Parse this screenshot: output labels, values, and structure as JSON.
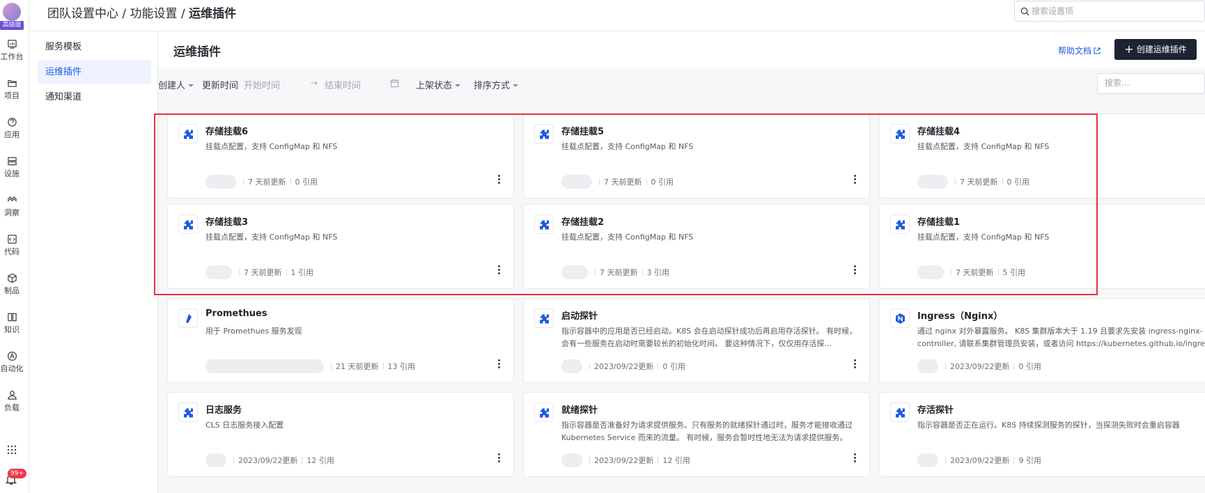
{
  "rail": {
    "badge": "高级版",
    "items": [
      {
        "label": "工作台",
        "icon": "dashboard-icon"
      },
      {
        "label": "项目",
        "icon": "folder-icon"
      },
      {
        "label": "应用",
        "icon": "app-icon"
      },
      {
        "label": "设施",
        "icon": "server-icon"
      },
      {
        "label": "洞察",
        "icon": "insight-icon"
      },
      {
        "label": "代码",
        "icon": "code-icon"
      },
      {
        "label": "制品",
        "icon": "package-icon"
      },
      {
        "label": "知识",
        "icon": "book-icon"
      },
      {
        "label": "自动化",
        "icon": "automation-icon"
      },
      {
        "label": "负载",
        "icon": "user-icon"
      }
    ],
    "notification_count": "99+"
  },
  "header": {
    "breadcrumb": [
      "团队设置中心",
      "功能设置",
      "运维插件"
    ],
    "separator": " / ",
    "search_placeholder": "搜索设置项"
  },
  "subnav": {
    "items": [
      {
        "label": "服务模板",
        "active": false
      },
      {
        "label": "运维插件",
        "active": true
      },
      {
        "label": "通知渠道",
        "active": false
      }
    ]
  },
  "main": {
    "title": "运维插件",
    "help_label": "帮助文档",
    "create_label": "创建运维插件",
    "filters": {
      "creator": "创建人",
      "updated": "更新时间",
      "start_placeholder": "开始时间",
      "end_placeholder": "结束时间",
      "status": "上架状态",
      "sort": "排序方式",
      "search_placeholder": "搜索..."
    },
    "cards": [
      {
        "title": "存储挂载6",
        "desc": "挂载点配置，支持 ConfigMap 和 NFS",
        "updated": "7 天前更新",
        "refs": "0 引用",
        "icon": "puzzle-icon"
      },
      {
        "title": "存储挂载5",
        "desc": "挂载点配置，支持 ConfigMap 和 NFS",
        "updated": "7 天前更新",
        "refs": "0 引用",
        "icon": "puzzle-icon"
      },
      {
        "title": "存储挂载4",
        "desc": "挂载点配置，支持 ConfigMap 和 NFS",
        "updated": "7 天前更新",
        "refs": "0 引用",
        "icon": "puzzle-icon"
      },
      {
        "title": "存储挂载3",
        "desc": "挂载点配置，支持 ConfigMap 和 NFS",
        "updated": "7 天前更新",
        "refs": "1 引用",
        "icon": "puzzle-icon"
      },
      {
        "title": "存储挂载2",
        "desc": "挂载点配置，支持 ConfigMap 和 NFS",
        "updated": "7 天前更新",
        "refs": "3 引用",
        "icon": "puzzle-icon"
      },
      {
        "title": "存储挂载1",
        "desc": "挂载点配置，支持 ConfigMap 和 NFS",
        "updated": "7 天前更新",
        "refs": "5 引用",
        "icon": "puzzle-icon"
      },
      {
        "title": "Promethues",
        "desc": "用于 Promethues 服务发现",
        "updated": "21 天前更新",
        "refs": "13 引用",
        "icon": "prometheus-icon"
      },
      {
        "title": "启动探针",
        "desc": "指示容器中的应用是否已经启动。K8S 会在启动探针成功后再启用存活探针。 有时候，会有一些服务在启动时需要较长的初始化时间。 要这种情况下，仅仅用存活探...",
        "updated": "2023/09/22更新",
        "refs": "0 引用",
        "icon": "puzzle-icon"
      },
      {
        "title": "Ingress（Nginx）",
        "desc": "通过 nginx 对外暴露服务。 K8S 集群版本大于 1.19 且要求先安装 ingress-nginx-controller, 请联系集群管理员安装，或者访问 https://kubernetes.github.io/ingress-nginx/d",
        "updated": "2023/09/22更新",
        "refs": "0 引用",
        "icon": "nginx-icon"
      },
      {
        "title": "日志服务",
        "desc": "CLS 日志服务接入配置",
        "updated": "2023/09/22更新",
        "refs": "12 引用",
        "icon": "puzzle-icon"
      },
      {
        "title": "就绪探针",
        "desc": "指示容器是否准备好为请求提供服务。只有服务的就绪探针通过时，服务才能接收通过 Kubernetes Service 而来的流量。 有时候，服务会暂时性地无法为请求提供服务。 例...",
        "updated": "2023/09/22更新",
        "refs": "12 引用",
        "icon": "puzzle-icon"
      },
      {
        "title": "存活探针",
        "desc": "指示容器是否正在运行。K8S 持续探测服务的探针，当探测失败时会重启容器",
        "updated": "2023/09/22更新",
        "refs": "9 引用",
        "icon": "puzzle-icon"
      }
    ]
  },
  "colors": {
    "accent": "#1f5be0",
    "dark_button": "#1c2433",
    "highlight": "#e3343f",
    "badge": "#6c4fd6",
    "notify": "#f0384f"
  }
}
